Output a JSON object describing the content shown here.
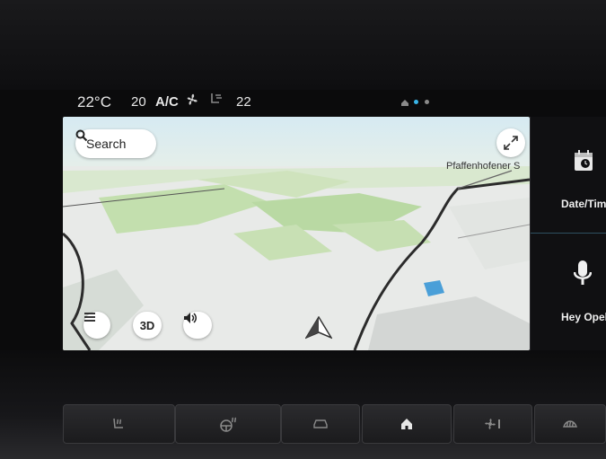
{
  "status_bar": {
    "temp_left": "22°C",
    "fan_level": "20",
    "ac_label": "A/C",
    "temp_right": "22",
    "page_dots": [
      {
        "active": false
      },
      {
        "active": true
      },
      {
        "active": false
      }
    ],
    "colors": {
      "active_dot": "#39b5e8",
      "inactive_dot": "#8a8a8a"
    }
  },
  "map": {
    "search": {
      "label": "Search",
      "icon": "search-icon"
    },
    "expand_icon": "expand-icon",
    "place_label": "Pfaffenhofener S",
    "buttons": {
      "menu_icon": "menu-icon",
      "mode_3d": "3D",
      "sound_icon": "volume-icon"
    },
    "nav_icon": "navigation-arrow-icon",
    "colors": {
      "sky": "#dfeef3",
      "land": "#e9ebe9",
      "green": "#bfdcaa",
      "water": "#4a9fd8",
      "road": "#2b2b2b"
    }
  },
  "side_panel": {
    "items": [
      {
        "label": "Date/Tim",
        "icon": "calendar-clock-icon"
      },
      {
        "label": "Hey Opel",
        "icon": "microphone-icon"
      }
    ]
  },
  "hardware_buttons": [
    {
      "icon": "heated-seat-icon"
    },
    {
      "icon": "heated-steering-wheel-icon"
    },
    {
      "icon": "car-icon"
    },
    {
      "icon": "home-icon"
    },
    {
      "icon": "climate-fan-icon"
    },
    {
      "icon": "defrost-icon"
    }
  ]
}
